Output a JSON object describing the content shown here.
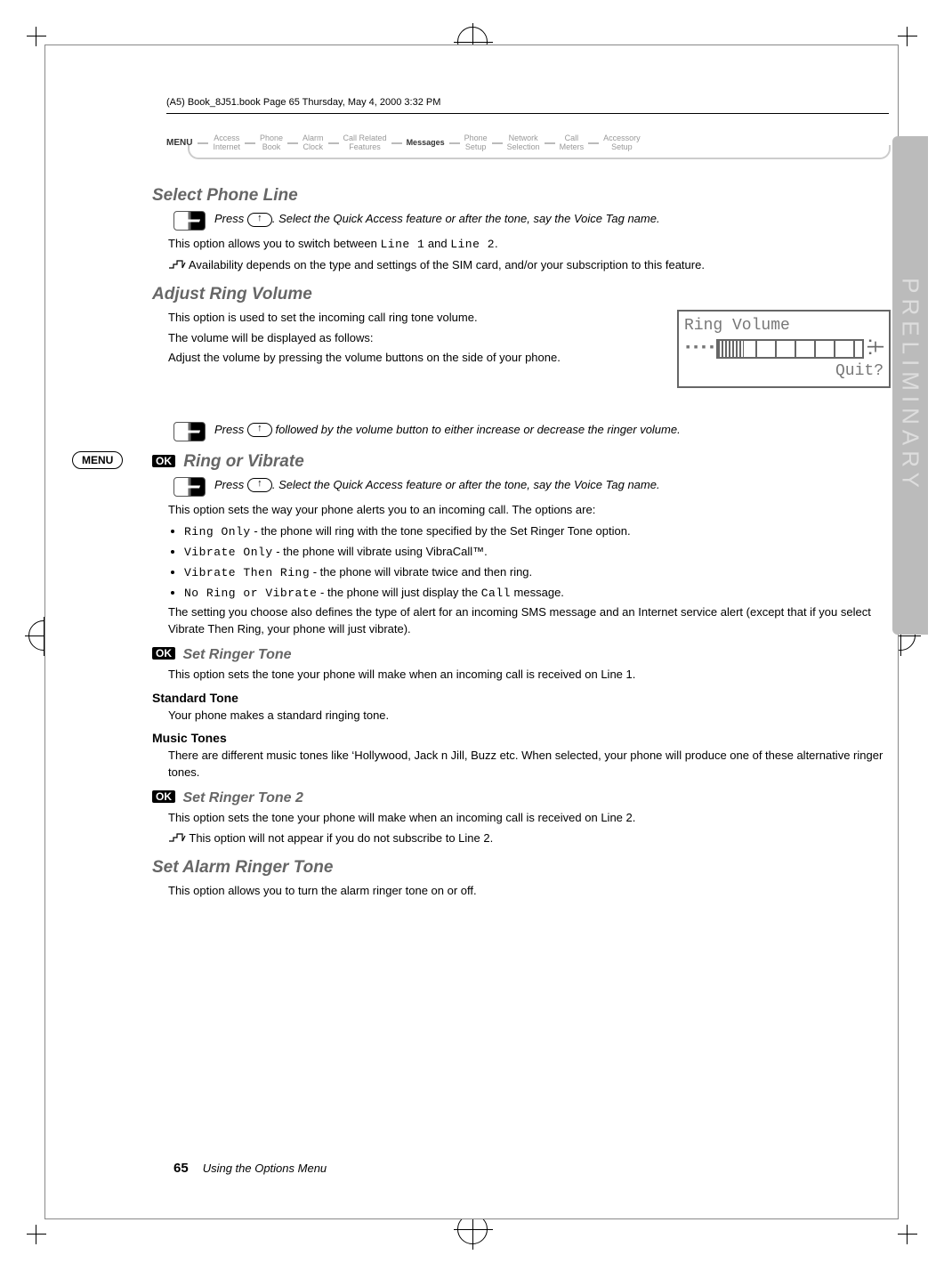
{
  "header_path": "(A5) Book_8J51.book  Page 65  Thursday, May 4, 2000  3:32 PM",
  "menu": {
    "label": "MENU",
    "items": [
      {
        "t1": "Access",
        "t2": "Internet"
      },
      {
        "t1": "Phone",
        "t2": "Book"
      },
      {
        "t1": "Alarm",
        "t2": "Clock"
      },
      {
        "t1": "Call Related",
        "t2": "Features"
      },
      {
        "t1": "Messages",
        "t2": "",
        "active": true
      },
      {
        "t1": "Phone",
        "t2": "Setup"
      },
      {
        "t1": "Network",
        "t2": "Selection"
      },
      {
        "t1": "Call",
        "t2": "Meters"
      },
      {
        "t1": "Accessory",
        "t2": "Setup"
      }
    ]
  },
  "sections": {
    "select_phone_line": {
      "title": "Select Phone Line",
      "callout": "Press ↑. Select the Quick Access feature or after the tone, say the Voice Tag name.",
      "p1": "This option allows you to switch between Line 1 and Line 2.",
      "p2": "Availability depends on the type and settings of the SIM card, and/or your subscription to this feature."
    },
    "adjust_ring_volume": {
      "title": "Adjust Ring Volume",
      "p1": "This option is used to set the incoming call ring tone volume.",
      "p2": "The volume will be displayed as follows:",
      "p3": "Adjust the volume by pressing the volume buttons on the side of your phone.",
      "callout": "Press ↑ followed by the volume button to either increase or decrease the ringer volume.",
      "display": {
        "title": "Ring Volume",
        "quit": "Quit?"
      }
    },
    "ring_or_vibrate": {
      "ok_badge": "OK",
      "title": "Ring or Vibrate",
      "callout": "Press ↑. Select the Quick Access feature or after the tone, say the Voice Tag name.",
      "intro": "This option sets the way your phone alerts you to an incoming call. The options are:",
      "bullets": [
        {
          "mono": "Ring Only",
          "rest": " - the phone will ring with the tone specified by the Set Ringer Tone option."
        },
        {
          "mono": "Vibrate Only",
          "rest": " - the phone will vibrate using VibraCall™."
        },
        {
          "mono": "Vibrate Then Ring",
          "rest": " - the phone will vibrate twice and then ring."
        },
        {
          "mono": "No Ring or Vibrate",
          "rest": " - the phone will just display the Call message."
        }
      ],
      "outro": "The setting you choose also defines the type of alert for an incoming SMS message and an Internet service alert (except that if you select Vibrate Then Ring, your phone will just vibrate)."
    },
    "set_ringer_tone": {
      "ok_badge": "OK",
      "title": "Set Ringer Tone",
      "p": "This option sets the tone your phone will make when an incoming call is received on Line 1.",
      "standard": {
        "h": "Standard Tone",
        "p": "Your phone makes a standard ringing tone."
      },
      "music": {
        "h": "Music Tones",
        "p": "There are different music tones like ‘Hollywood, Jack n Jill, Buzz etc. When selected, your phone will produce one of these alternative ringer tones."
      }
    },
    "set_ringer_tone_2": {
      "ok_badge": "OK",
      "title": "Set Ringer Tone 2",
      "p1": "This option sets the tone your phone will make when an incoming call is received on Line 2.",
      "p2": "This option will not appear if you do not subscribe to Line 2."
    },
    "set_alarm_ringer_tone": {
      "title": "Set Alarm Ringer Tone",
      "p": "This option allows you to turn the alarm ringer tone on or off."
    }
  },
  "side_tab": "PRELIMINARY",
  "side_pill": "MENU",
  "footer": {
    "page": "65",
    "title": "Using the Options Menu"
  }
}
